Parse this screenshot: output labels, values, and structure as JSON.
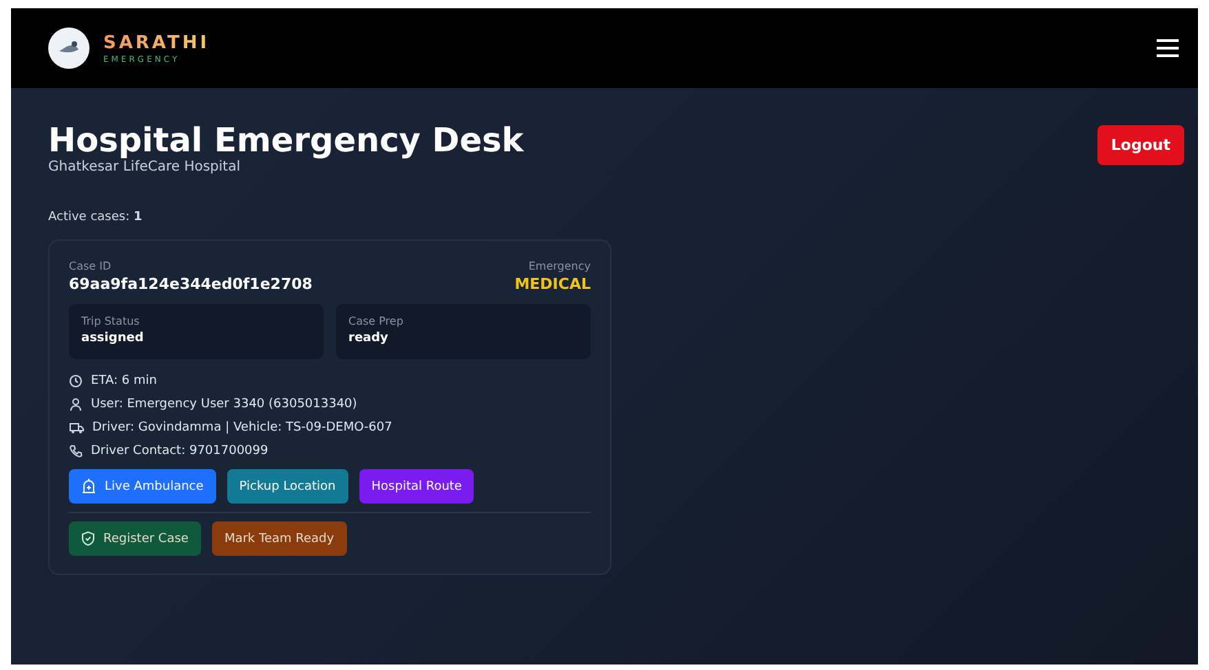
{
  "header": {
    "brand": "SARATHI",
    "tagline": "EMERGENCY"
  },
  "page": {
    "title": "Hospital Emergency Desk",
    "subtitle": "Ghatkesar LifeCare Hospital",
    "logout": "Logout",
    "active_label": "Active cases:",
    "active_count": "1"
  },
  "cases": [
    {
      "case_id_label": "Case ID",
      "case_id": "69aa9fa124e344ed0f1e2708",
      "emergency_label": "Emergency",
      "emergency": "MEDICAL",
      "stats": [
        {
          "label": "Trip Status",
          "value": "assigned"
        },
        {
          "label": "Case Prep",
          "value": "ready"
        }
      ],
      "details": [
        {
          "kind": "clock",
          "text": "ETA: 6 min"
        },
        {
          "kind": "user",
          "text": "User: Emergency User 3340 (6305013340)"
        },
        {
          "kind": "truck",
          "text": "Driver: Govindamma | Vehicle: TS-09-DEMO-607"
        },
        {
          "kind": "phone",
          "text": "Driver Contact: 9701700099"
        }
      ],
      "links": [
        {
          "label": "Live Ambulance",
          "kind": "ambulance",
          "color": "#1f6fff"
        },
        {
          "label": "Pickup Location",
          "kind": "plain",
          "color": "#137a95"
        },
        {
          "label": "Hospital Route",
          "kind": "plain",
          "color": "#7a1cf0"
        }
      ],
      "actions": [
        {
          "label": "Register Case",
          "kind": "shield",
          "color": "#0f5a3c"
        },
        {
          "label": "Mark Team Ready",
          "kind": "plain",
          "color": "#8a3c0c"
        }
      ]
    }
  ]
}
